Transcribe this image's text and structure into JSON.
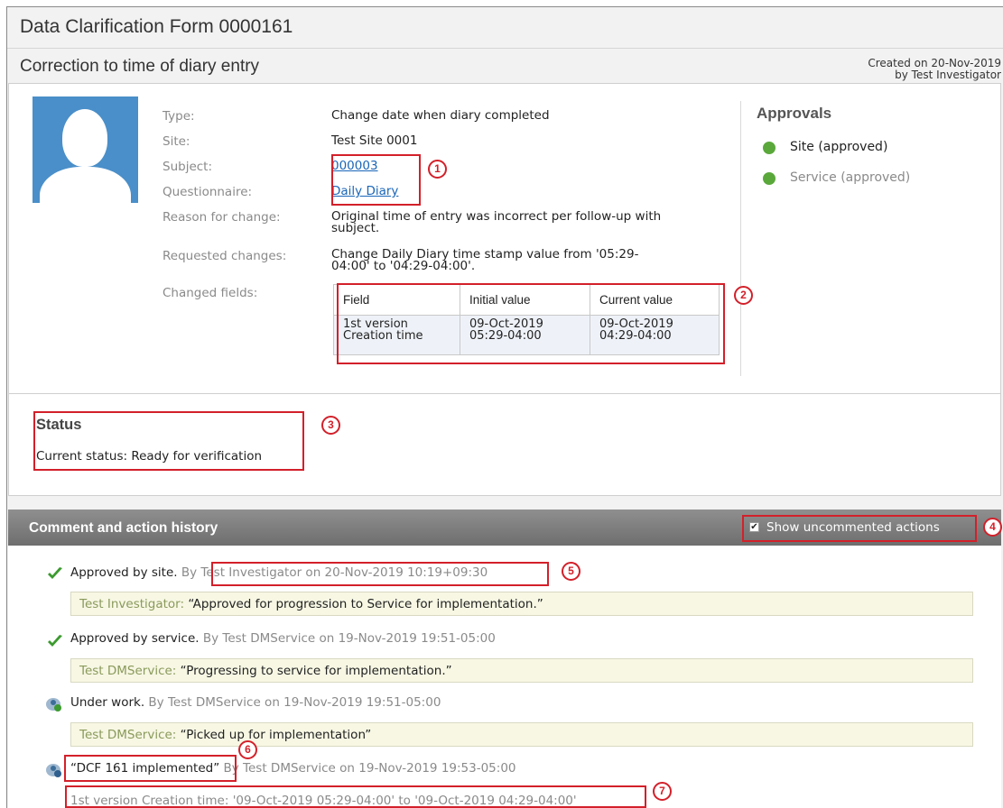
{
  "form": {
    "title": "Data Clarification Form 0000161",
    "subtitle": "Correction to time of diary entry",
    "created_line1": "Created on 20-Nov-2019",
    "created_line2": "by Test Investigator"
  },
  "details": {
    "labels": {
      "type": "Type:",
      "site": "Site:",
      "subject": "Subject:",
      "questionnaire": "Questionnaire:",
      "reason": "Reason for change:",
      "requested": "Requested changes:",
      "changed_fields": "Changed fields:"
    },
    "values": {
      "type": "Change date when diary completed",
      "site": "Test Site 0001",
      "subject": "000003",
      "questionnaire": "Daily Diary",
      "reason_line1": "Original time of entry was incorrect per follow-up with",
      "reason_line2": "subject.",
      "requested_line1": "Change Daily Diary time stamp value from '05:29-",
      "requested_line2": "04:00' to '04:29-04:00'."
    },
    "changes_table": {
      "headers": [
        "Field",
        "Initial value",
        "Current value"
      ],
      "row": {
        "field_line1": "1st version",
        "field_line2": "Creation time",
        "initial_line1": "09-Oct-2019",
        "initial_line2": "05:29-04:00",
        "current_line1": "09-Oct-2019",
        "current_line2": "04:29-04:00"
      }
    }
  },
  "approvals": {
    "title": "Approvals",
    "items": [
      {
        "label": "Site (approved)",
        "color": "#222222"
      },
      {
        "label": "Service (approved)",
        "color": "#8a8a8a"
      }
    ],
    "dot_color": "#5aa83b"
  },
  "status": {
    "title": "Status",
    "text": "Current status: Ready for verification"
  },
  "history": {
    "title": "Comment and action history",
    "show_uncommented_label": "Show uncommented actions",
    "show_uncommented_checked": true,
    "entries": [
      {
        "icon": "green-check-icon",
        "action": "Approved by site.",
        "by": " By Test Investigator on 20-Nov-2019 10:19+09:30",
        "comment_author": "Test Investigator:",
        "comment_text": " “Approved for progression to Service for implementation.”"
      },
      {
        "icon": "green-check-icon",
        "action": "Approved by service.",
        "by": " By Test DMService on 19-Nov-2019 19:51-05:00",
        "comment_author": "Test DMService:",
        "comment_text": " “Progressing to service for implementation.”"
      },
      {
        "icon": "user-working-icon",
        "action": "Under work.",
        "by": " By Test DMService on 19-Nov-2019 19:51-05:00",
        "comment_author": "Test DMService:",
        "comment_text": " “Picked up for implementation”"
      },
      {
        "icon": "user-info-icon",
        "action": "“DCF 161 implemented”",
        "by": " By Test DMService on 19-Nov-2019 19:53-05:00"
      }
    ],
    "change_detail": "1st version Creation time: '09-Oct-2019 05:29-04:00' to '09-Oct-2019 04:29-04:00'"
  },
  "annotation_markers": [
    "1",
    "2",
    "3",
    "4",
    "5",
    "6",
    "7"
  ],
  "colors": {
    "highlight": "#d3202a",
    "link": "#1a66b8",
    "comment_bg": "#f7f7e4",
    "header_bar": "#7d7d7d"
  }
}
